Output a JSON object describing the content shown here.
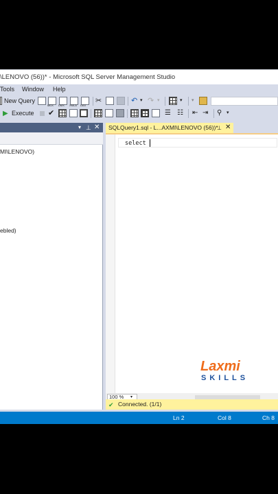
{
  "window": {
    "title": "\\LENOVO (56))* - Microsoft SQL Server Management Studio"
  },
  "menu": [
    "Tools",
    "Window",
    "Help"
  ],
  "toolbar": {
    "new_query_label": "New Query",
    "execute_label": "Execute",
    "mini_labels": [
      "MDX",
      "DMX",
      "XMLA",
      "DAX"
    ]
  },
  "left_panel": {
    "server_node": "MI\\LENOVO)",
    "partial_node": "ebled)"
  },
  "editor": {
    "tab_title": "SQLQuery1.sql - L...AXMI\\LENOVO (56))*",
    "code": "select ",
    "zoom": "100 %"
  },
  "connection": {
    "status": "Connected. (1/1)"
  },
  "status_bar": {
    "line": "Ln 2",
    "col": "Col 8",
    "char": "Ch 8"
  },
  "logo": {
    "word1": "Laxmi",
    "word2": "SKILLS",
    "colors": {
      "orange": "#ef6c1a",
      "blue": "#1b4f9c"
    }
  }
}
